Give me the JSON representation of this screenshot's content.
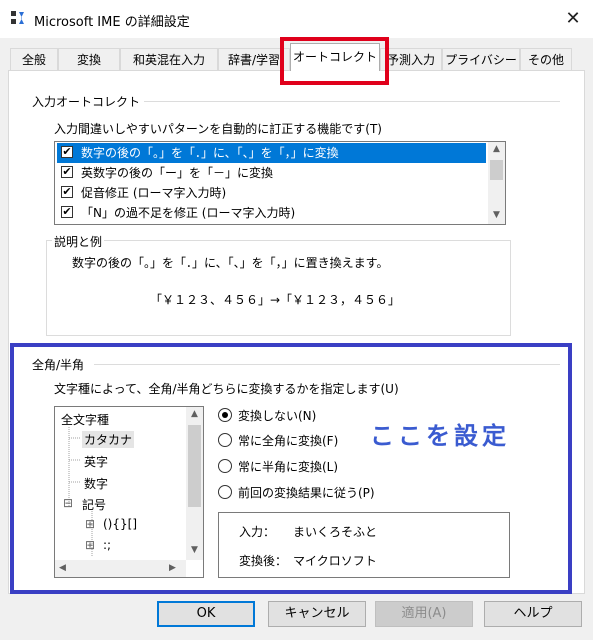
{
  "window": {
    "title": "Microsoft IME の詳細設定",
    "close_glyph": "✕"
  },
  "tabs": [
    {
      "label": "全般"
    },
    {
      "label": "変換"
    },
    {
      "label": "和英混在入力"
    },
    {
      "label": "辞書/学習"
    },
    {
      "label": "オートコレクト"
    },
    {
      "label": "予測入力"
    },
    {
      "label": "プライバシー"
    },
    {
      "label": "その他"
    }
  ],
  "active_tab": "オートコレクト",
  "input_autocorrect": {
    "group_title": "入力オートコレクト",
    "description": "入力間違いしやすいパターンを自動的に訂正する機能です(T)",
    "items": [
      {
        "label": "数字の後の「。」を「．」に、「、」を「，」に変換",
        "checked": true,
        "selected": true
      },
      {
        "label": "英数字の後の「ー」を「－」に変換",
        "checked": true,
        "selected": false
      },
      {
        "label": "促音修正 (ローマ字入力時)",
        "checked": true,
        "selected": false
      },
      {
        "label": "「N」の過不足を修正 (ローマ字入力時)",
        "checked": true,
        "selected": false
      }
    ],
    "check_glyph": "✔"
  },
  "explanation": {
    "title": "説明と例",
    "text": "数字の後の「。」を「．」に、「、」を「，」に置き換えます。",
    "example": "「￥１２３、４５６」→「￥１２３，４５６」"
  },
  "fullwidth": {
    "group_title": "全角/半角",
    "description": "文字種によって、全角/半角どちらに変換するかを指定します(U)",
    "tree": [
      {
        "label": "全文字種",
        "level": 0
      },
      {
        "label": "カタカナ",
        "level": 1,
        "selected": true
      },
      {
        "label": "英字",
        "level": 1
      },
      {
        "label": "数字",
        "level": 1
      },
      {
        "label": "記号",
        "level": 1,
        "expander": "⊟"
      },
      {
        "label": "(){}[]",
        "level": 2,
        "expander": "⊞"
      },
      {
        "label": ":;",
        "level": 2,
        "expander": "⊞"
      }
    ],
    "options": [
      {
        "label": "変換しない(N)",
        "selected": true
      },
      {
        "label": "常に全角に変換(F)",
        "selected": false
      },
      {
        "label": "常に半角に変換(L)",
        "selected": false
      },
      {
        "label": "前回の変換結果に従う(P)",
        "selected": false
      }
    ],
    "example": {
      "input_label": "入力：",
      "input_value": "まいくろそふと",
      "output_label": "変換後：",
      "output_value": "マイクロソフト"
    }
  },
  "annotation": "ここを設定",
  "buttons": {
    "ok": "OK",
    "cancel": "キャンセル",
    "apply": "適用(A)",
    "help": "ヘルプ"
  },
  "colors": {
    "highlight_red": "#e0001b",
    "highlight_blue": "#3a3fc4",
    "selection": "#0078d7",
    "annotation_text": "#3a5bd0"
  }
}
